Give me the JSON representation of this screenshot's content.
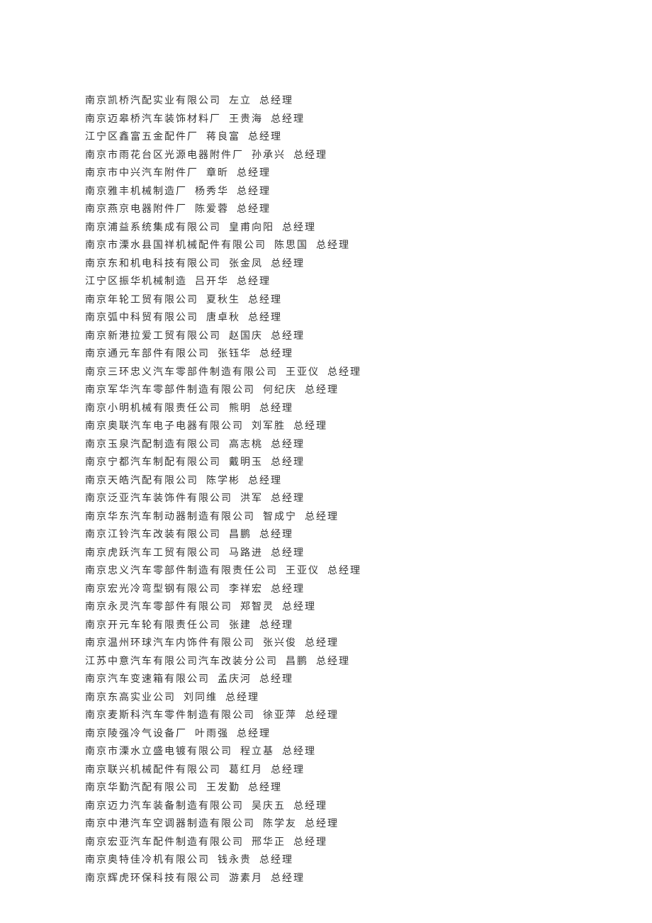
{
  "entries": [
    {
      "company": "南京凯桥汽配实业有限公司",
      "person": "左立",
      "title": "总经理"
    },
    {
      "company": "南京迈皋桥汽车装饰材料厂",
      "person": "王贵海",
      "title": "总经理"
    },
    {
      "company": "江宁区鑫富五金配件厂",
      "person": "蒋良富",
      "title": "总经理"
    },
    {
      "company": "南京市雨花台区光源电器附件厂",
      "person": "孙承兴",
      "title": "总经理"
    },
    {
      "company": "南京市中兴汽车附件厂",
      "person": "章昕",
      "title": "总经理"
    },
    {
      "company": "南京雅丰机械制造厂",
      "person": "杨秀华",
      "title": "总经理"
    },
    {
      "company": "南京燕京电器附件厂",
      "person": "陈爱蓉",
      "title": "总经理"
    },
    {
      "company": "南京浦益系统集成有限公司",
      "person": "皇甫向阳",
      "title": "总经理"
    },
    {
      "company": "南京市溧水县国祥机械配件有限公司",
      "person": "陈思国",
      "title": "总经理"
    },
    {
      "company": "南京东和机电科技有限公司",
      "person": "张金凤",
      "title": "总经理"
    },
    {
      "company": "江宁区振华机械制造",
      "person": "吕开华",
      "title": "总经理"
    },
    {
      "company": "南京年轮工贸有限公司",
      "person": "夏秋生",
      "title": "总经理"
    },
    {
      "company": "南京弧中科贸有限公司",
      "person": "唐卓秋",
      "title": "总经理"
    },
    {
      "company": "南京新港拉爱工贸有限公司",
      "person": "赵国庆",
      "title": "总经理"
    },
    {
      "company": "南京通元车部件有限公司",
      "person": "张钰华",
      "title": "总经理"
    },
    {
      "company": "南京三环忠义汽车零部件制造有限公司",
      "person": "王亚仪",
      "title": "总经理"
    },
    {
      "company": "南京军华汽车零部件制造有限公司",
      "person": "何纪庆",
      "title": "总经理"
    },
    {
      "company": "南京小明机械有限责任公司",
      "person": "熊明",
      "title": "总经理"
    },
    {
      "company": "南京奥联汽车电子电器有限公司",
      "person": "刘军胜",
      "title": "总经理"
    },
    {
      "company": "南京玉泉汽配制造有限公司",
      "person": "高志桃",
      "title": "总经理"
    },
    {
      "company": "南京宁都汽车制配有限公司",
      "person": "戴明玉",
      "title": "总经理"
    },
    {
      "company": "南京天皓汽配有限公司",
      "person": "陈学彬",
      "title": "总经理"
    },
    {
      "company": "南京泛亚汽车装饰件有限公司",
      "person": "洪军",
      "title": "总经理"
    },
    {
      "company": "南京华东汽车制动器制造有限公司",
      "person": "智成宁",
      "title": "总经理"
    },
    {
      "company": "南京江铃汽车改装有限公司",
      "person": "昌鹏",
      "title": "总经理"
    },
    {
      "company": "南京虎跃汽车工贸有限公司",
      "person": "马路进",
      "title": "总经理"
    },
    {
      "company": "南京忠义汽车零部件制造有限责任公司",
      "person": "王亚仪",
      "title": "总经理"
    },
    {
      "company": "南京宏光冷弯型钢有限公司",
      "person": "李祥宏",
      "title": "总经理"
    },
    {
      "company": "南京永灵汽车零部件有限公司",
      "person": "郑智灵",
      "title": "总经理"
    },
    {
      "company": "南京开元车轮有限责任公司",
      "person": "张建",
      "title": "总经理"
    },
    {
      "company": "南京温州环球汽车内饰件有限公司",
      "person": "张兴俊",
      "title": "总经理"
    },
    {
      "company": "江苏中意汽车有限公司汽车改装分公司",
      "person": "昌鹏",
      "title": "总经理"
    },
    {
      "company": "南京汽车变速箱有限公司",
      "person": "孟庆河",
      "title": "总经理"
    },
    {
      "company": "南京东高实业公司",
      "person": "刘同维",
      "title": "总经理"
    },
    {
      "company": "南京麦斯科汽车零件制造有限公司",
      "person": "徐亚萍",
      "title": "总经理"
    },
    {
      "company": "南京陵强冷气设备厂",
      "person": "叶雨强",
      "title": "总经理"
    },
    {
      "company": "南京市溧水立盛电镀有限公司",
      "person": "程立基",
      "title": "总经理"
    },
    {
      "company": "南京联兴机械配件有限公司",
      "person": "葛红月",
      "title": "总经理"
    },
    {
      "company": "南京华勤汽配有限公司",
      "person": "王发勤",
      "title": "总经理"
    },
    {
      "company": "南京迈力汽车装备制造有限公司",
      "person": "吴庆五",
      "title": "总经理"
    },
    {
      "company": "南京中港汽车空调器制造有限公司",
      "person": "陈学友",
      "title": "总经理"
    },
    {
      "company": "南京宏亚汽车配件制造有限公司",
      "person": "邢华正",
      "title": "总经理"
    },
    {
      "company": "南京奥特佳冷机有限公司",
      "person": "钱永贵",
      "title": "总经理"
    },
    {
      "company": "南京辉虎环保科技有限公司",
      "person": "游素月",
      "title": "总经理"
    }
  ]
}
